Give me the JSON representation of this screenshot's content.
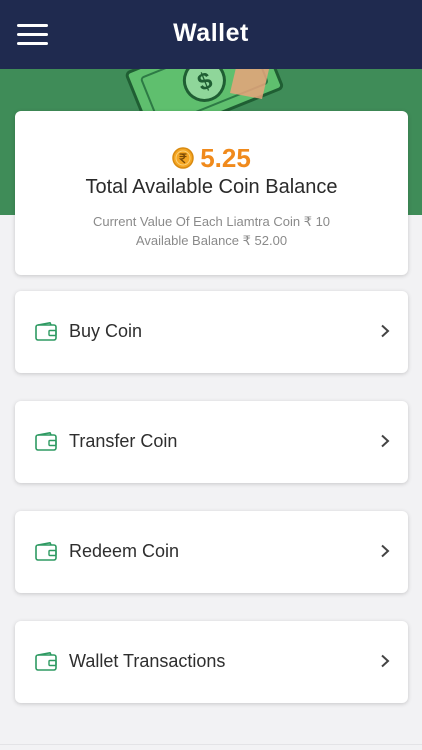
{
  "header": {
    "title": "Wallet",
    "menu_icon": "hamburger-menu-icon"
  },
  "colors": {
    "header_bg": "#1f2a4f",
    "banner_bg": "#3f8c58",
    "coin_accent": "#f08a1c",
    "wallet_icon": "#2e9a62"
  },
  "balance": {
    "coin_value": "5.25",
    "title": "Total Available Coin Balance",
    "coin_value_line": "Current Value Of Each Liamtra Coin ₹ 10",
    "available_line": "Available Balance ₹ 52.00"
  },
  "menu": [
    {
      "label": "Buy Coin",
      "icon": "wallet-icon"
    },
    {
      "label": "Transfer Coin",
      "icon": "wallet-icon"
    },
    {
      "label": "Redeem Coin",
      "icon": "wallet-icon"
    },
    {
      "label": "Wallet Transactions",
      "icon": "wallet-icon"
    }
  ]
}
